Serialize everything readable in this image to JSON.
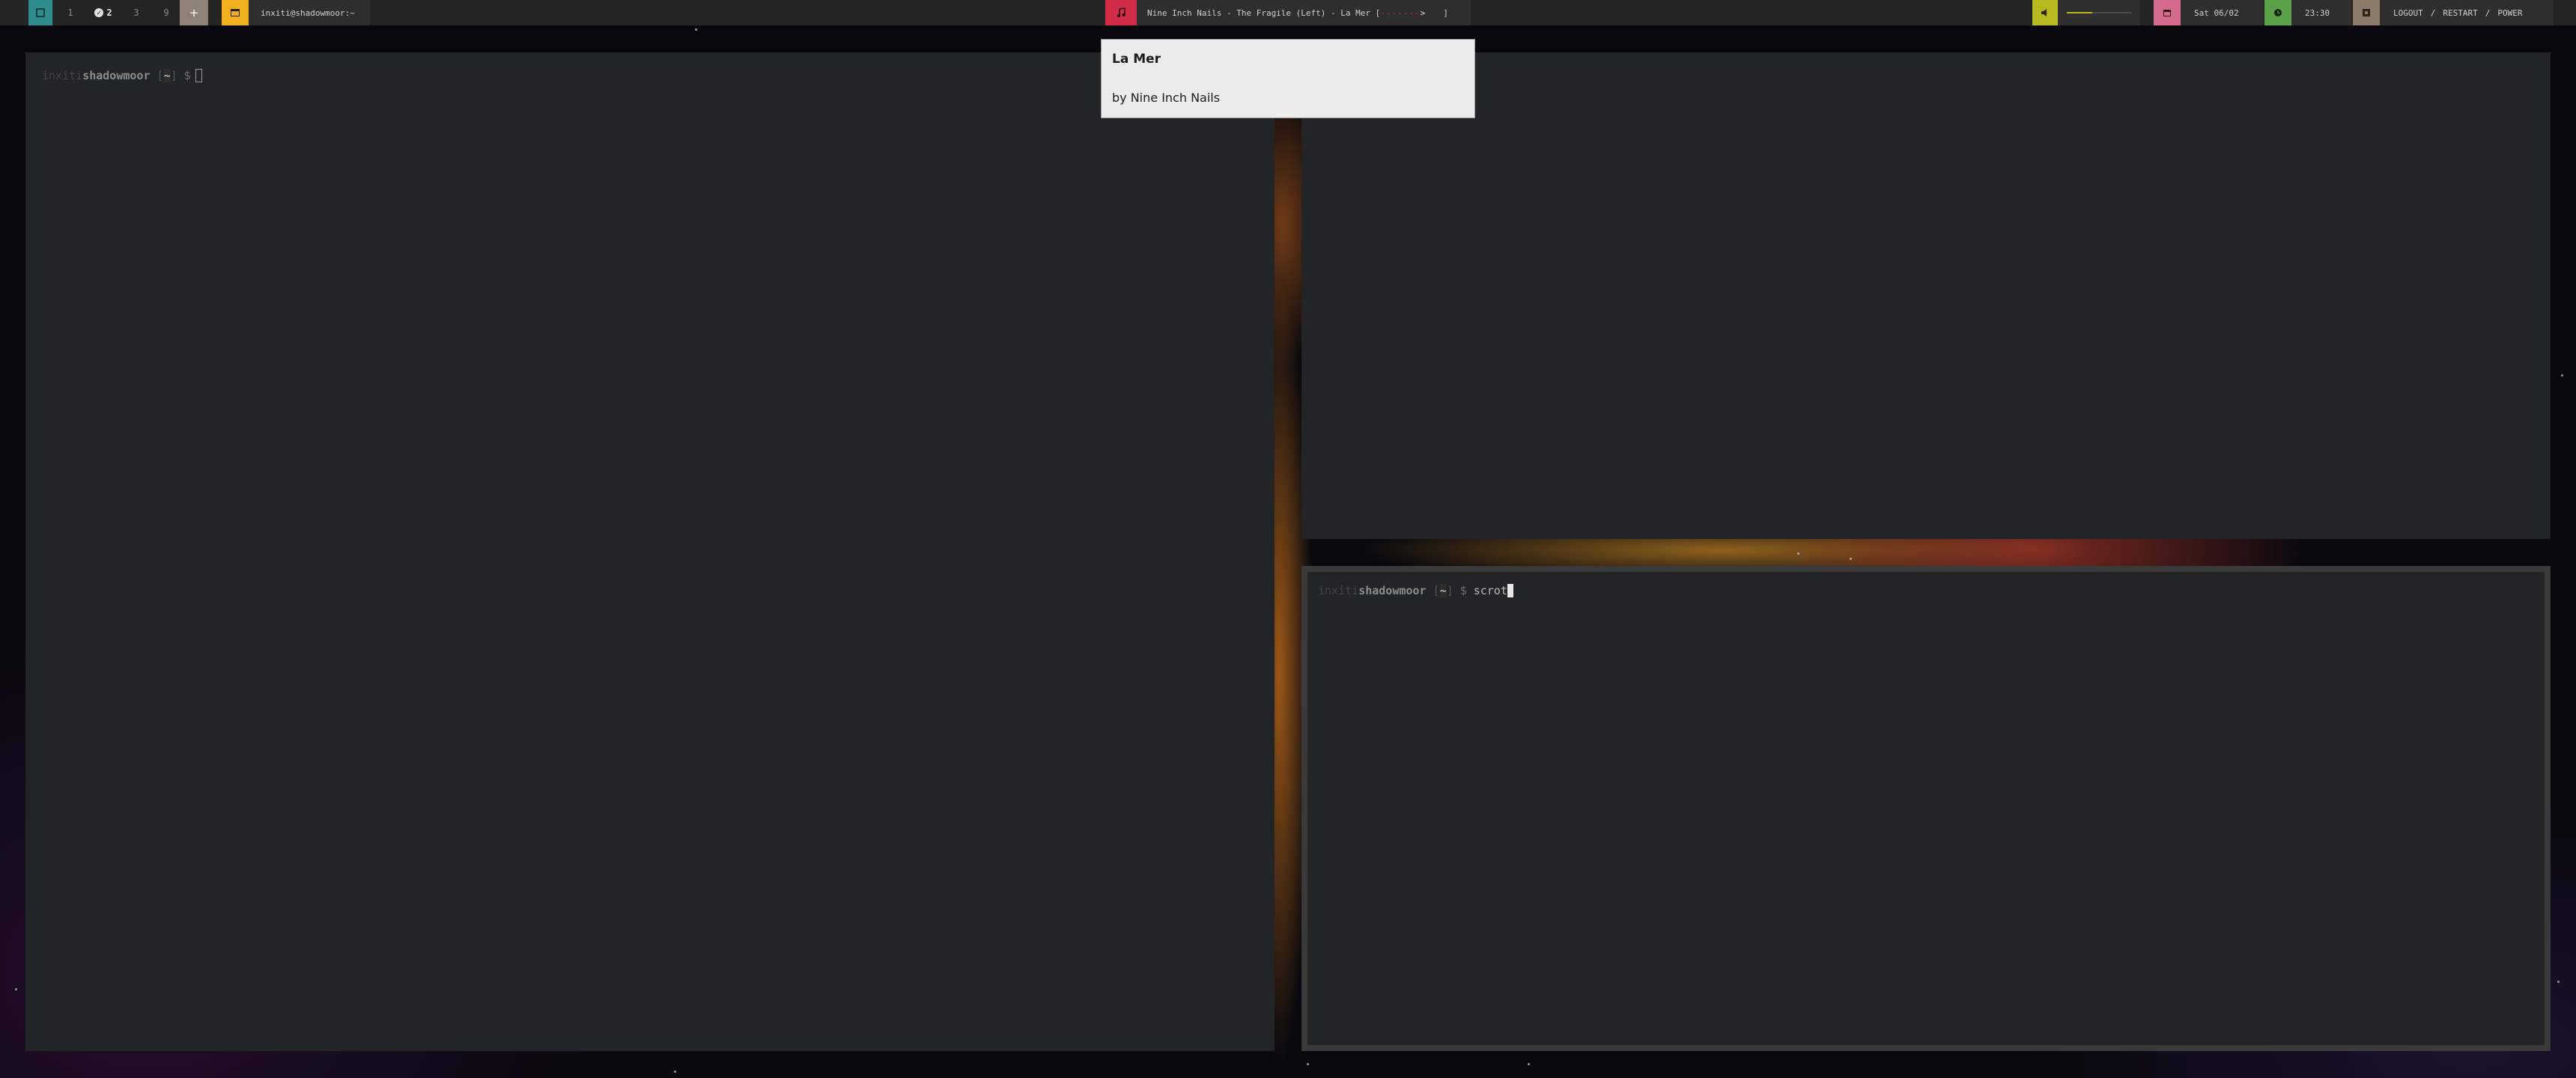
{
  "workspaces": [
    {
      "label": "1",
      "state": "inactive"
    },
    {
      "label": "2",
      "state": "active",
      "icon": "check-icon"
    },
    {
      "label": "3",
      "state": "inactive"
    },
    {
      "label": "9",
      "state": "inactive"
    },
    {
      "label": "+",
      "state": "add"
    }
  ],
  "window_title": "inxiti@shadowmoor:~",
  "media": {
    "icon": "music-note-icon",
    "text": "Nine Inch Nails - The Fragile (Left) - La Mer [",
    "progress_bar": "-------",
    "progress_end": ">",
    "progress_close": "]",
    "progress_fraction": 0.85,
    "color": "#d22c4b"
  },
  "volume": {
    "icon": "speaker-icon",
    "level": 0.4,
    "color": "#b8b820"
  },
  "date": {
    "icon": "calendar-icon",
    "text": "Sat 06/02",
    "color": "#d46a8c"
  },
  "time": {
    "icon": "clock-icon",
    "text": "23:30",
    "color": "#5ca04a"
  },
  "session": {
    "icon": "power-icon",
    "logout": "LOGOUT",
    "sep": "/",
    "restart": "RESTART",
    "power": "POWER",
    "color": "#8c7b6b"
  },
  "terminals": {
    "left": {
      "user": "inxiti",
      "host": "shadowmoor",
      "dir_open": "[",
      "dir": "~",
      "dir_close": "]",
      "symbol": "$",
      "command": ""
    },
    "top_right": {
      "symbol": "$",
      "command": ""
    },
    "bottom_right": {
      "user": "inxiti",
      "host": "shadowmoor",
      "dir_open": "[",
      "dir": "~",
      "dir_close": "]",
      "symbol": "$",
      "command": "scrot"
    }
  },
  "notification": {
    "title": "La Mer",
    "body": "by Nine Inch Nails"
  },
  "colors": {
    "accent_teal": "#2e8c8c",
    "accent_orange": "#f0b020",
    "bar_bg": "#242424",
    "terminal_bg": "#222426"
  }
}
